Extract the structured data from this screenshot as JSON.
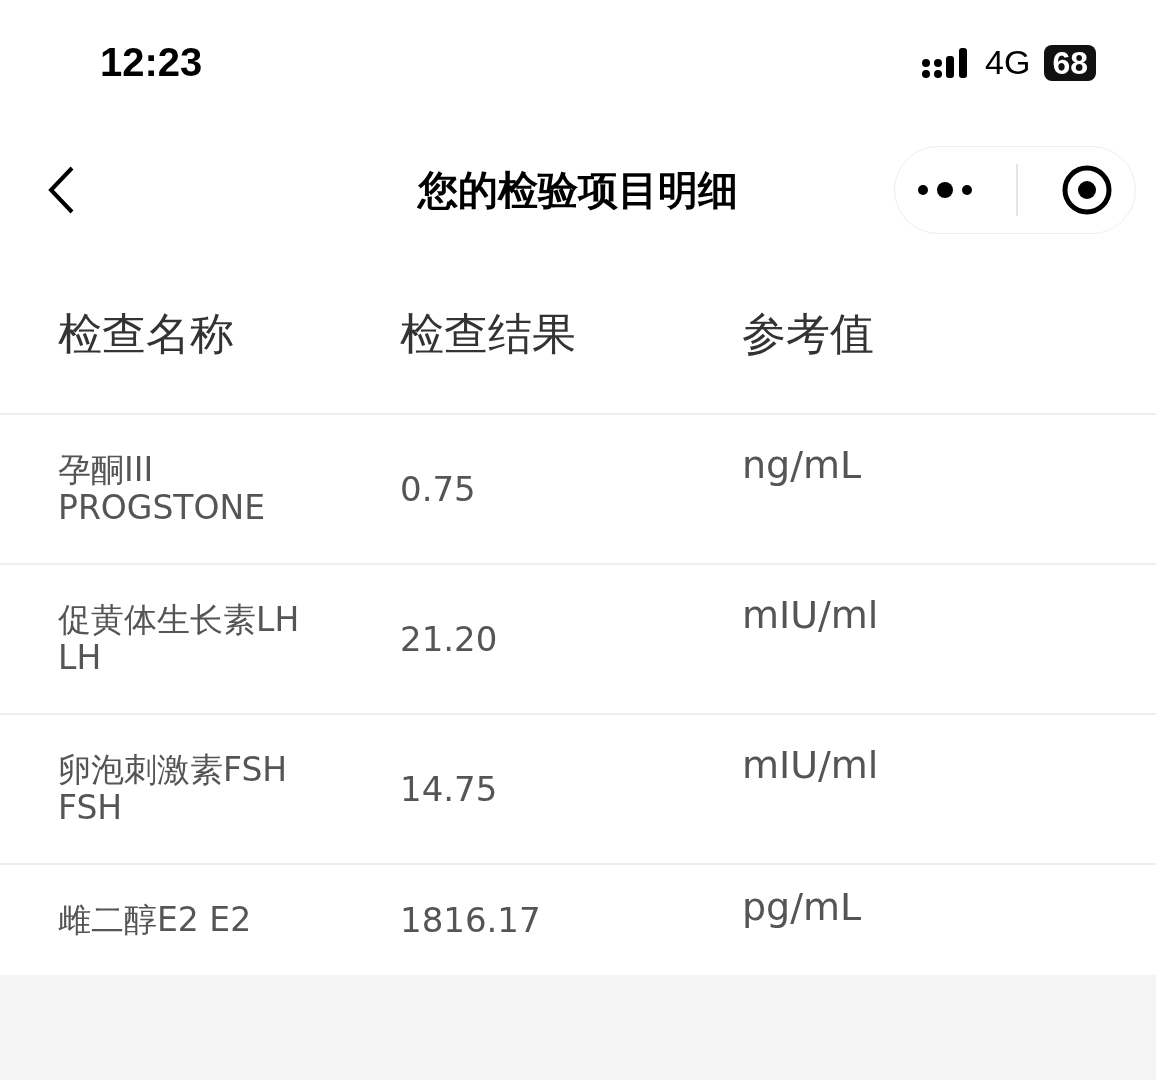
{
  "status_bar": {
    "time": "12:23",
    "network": "4G",
    "battery": "68"
  },
  "nav_bar": {
    "title": "您的检验项目明细"
  },
  "table": {
    "columns": [
      "检查名称",
      "检查结果",
      "参考值"
    ],
    "rows": [
      {
        "name": [
          "孕酮III",
          "PROGSTONE"
        ],
        "result": "0.75",
        "reference": "ng/mL"
      },
      {
        "name": [
          "促黄体生长素LH",
          "LH"
        ],
        "result": "21.20",
        "reference": "mIU/ml"
      },
      {
        "name": [
          "卵泡刺激素FSH",
          "FSH"
        ],
        "result": "14.75",
        "reference": "mIU/ml"
      },
      {
        "name": [
          "雌二醇E2 E2"
        ],
        "result": "1816.17",
        "reference": "pg/mL"
      }
    ]
  }
}
